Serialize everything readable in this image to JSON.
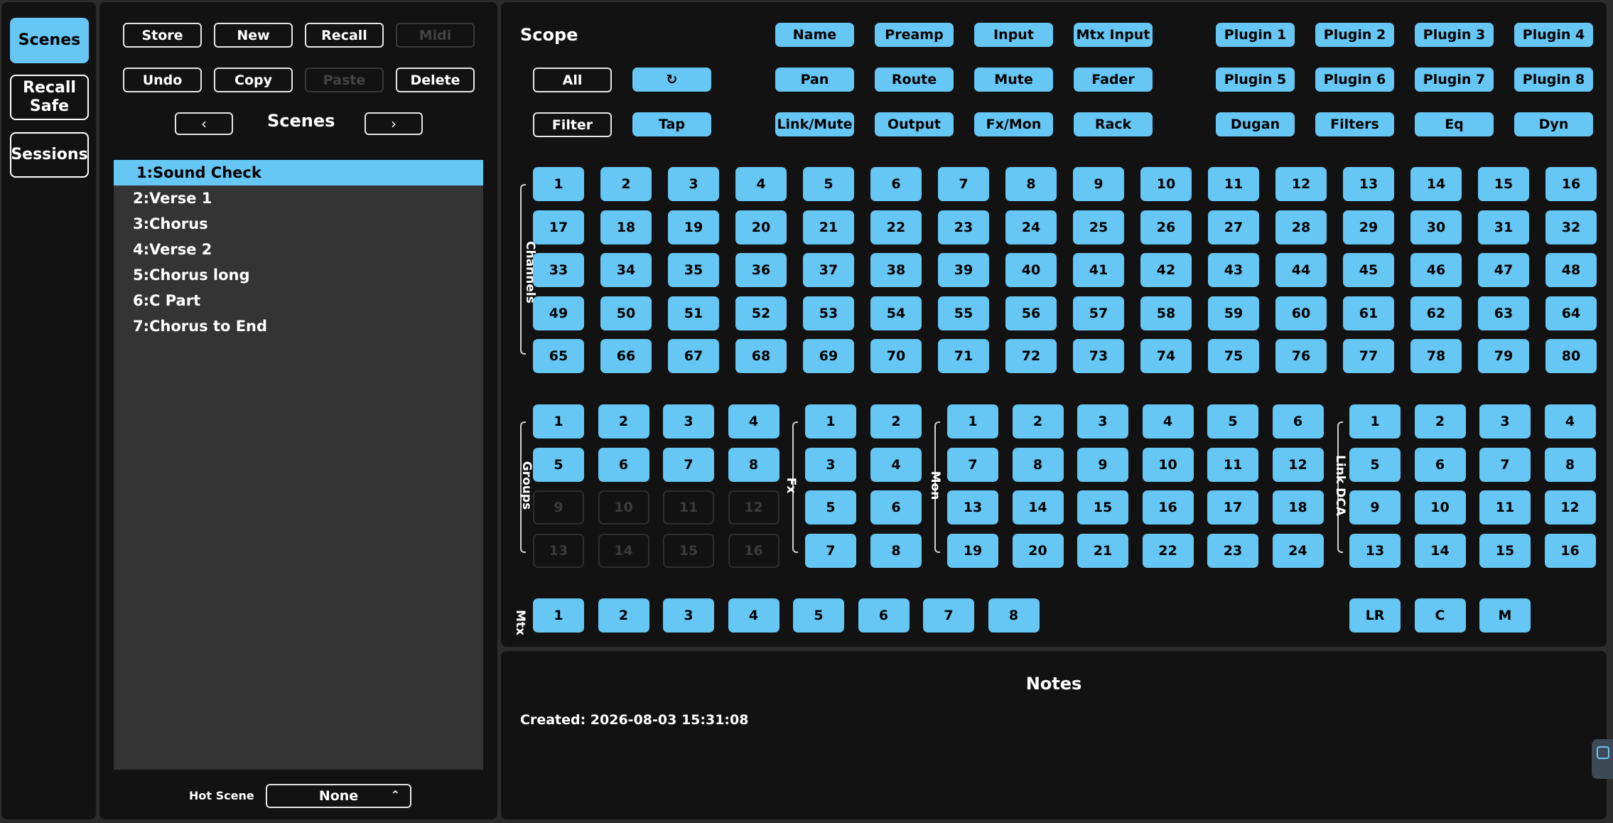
{
  "nav": {
    "scenes": "Scenes",
    "recall_safe_line1": "Recall",
    "recall_safe_line2": "Safe",
    "sessions": "Sessions"
  },
  "scenes_panel": {
    "toolbar": {
      "store": "Store",
      "new": "New",
      "recall": "Recall",
      "midi": "Midi",
      "undo": "Undo",
      "copy": "Copy",
      "paste": "Paste",
      "delete": "Delete"
    },
    "prev": "‹",
    "next": "›",
    "title": "Scenes",
    "list": [
      "1:Sound Check",
      "2:Verse 1",
      "3:Chorus",
      "4:Verse 2",
      "5:Chorus long",
      "6:C Part",
      "7:Chorus to End"
    ],
    "hot_scene_label": "Hot Scene",
    "hot_scene_value": "None",
    "hot_scene_caret": "⌃"
  },
  "scope": {
    "title": "Scope",
    "all": "All",
    "filter": "Filter",
    "tap": "Tap",
    "refresh_icon": "↻",
    "filters_col1": [
      "Name",
      "Pan",
      "Link/Mute"
    ],
    "filters_col2": [
      "Preamp",
      "Route",
      "Output"
    ],
    "filters_col3": [
      "Input",
      "Mute",
      "Fx/Mon"
    ],
    "filters_col4": [
      "Mtx Input",
      "Fader",
      "Rack"
    ],
    "filters_col5": [
      "Plugin 1",
      "Plugin 5",
      "Dugan"
    ],
    "filters_col6": [
      "Plugin 2",
      "Plugin 6",
      "Filters"
    ],
    "filters_col7": [
      "Plugin 3",
      "Plugin 7",
      "Eq"
    ],
    "filters_col8": [
      "Plugin 4",
      "Plugin 8",
      "Dyn"
    ],
    "labels": {
      "channels": "Channels",
      "groups": "Groups",
      "fx": "Fx",
      "mon": "Mon",
      "link_dca": "Link DCA",
      "mtx": "Mtx"
    },
    "channels_count": 80,
    "groups": [
      {
        "label": "1",
        "enabled": true
      },
      {
        "label": "2",
        "enabled": true
      },
      {
        "label": "3",
        "enabled": true
      },
      {
        "label": "4",
        "enabled": true
      },
      {
        "label": "5",
        "enabled": true
      },
      {
        "label": "6",
        "enabled": true
      },
      {
        "label": "7",
        "enabled": true
      },
      {
        "label": "8",
        "enabled": true
      },
      {
        "label": "9",
        "enabled": false
      },
      {
        "label": "10",
        "enabled": false
      },
      {
        "label": "11",
        "enabled": false
      },
      {
        "label": "12",
        "enabled": false
      },
      {
        "label": "13",
        "enabled": false
      },
      {
        "label": "14",
        "enabled": false
      },
      {
        "label": "15",
        "enabled": false
      },
      {
        "label": "16",
        "enabled": false
      }
    ],
    "fx_count": 8,
    "mon_count": 24,
    "dca_count": 16,
    "mtx_count": 8,
    "mains": [
      "LR",
      "C",
      "M"
    ]
  },
  "notes": {
    "title": "Notes",
    "created": "Created: 2026-08-03 15:31:08"
  },
  "colors": {
    "accent": "#66c6f4",
    "panel": "#121212",
    "list_bg": "#343434"
  }
}
